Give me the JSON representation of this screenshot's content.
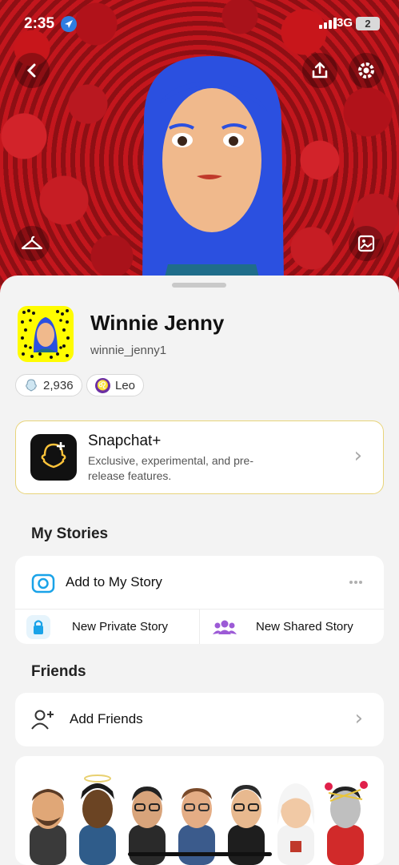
{
  "status_bar": {
    "time": "2:35",
    "network": "3G",
    "battery": "2"
  },
  "profile": {
    "display_name": "Winnie Jenny",
    "username": "winnie_jenny1",
    "score": "2,936",
    "zodiac": "Leo"
  },
  "snapchat_plus": {
    "title": "Snapchat+",
    "description": "Exclusive, experimental, and pre-release features."
  },
  "my_stories": {
    "heading": "My Stories",
    "add_label": "Add to My Story",
    "private_label": "New Private Story",
    "shared_label": "New Shared Story"
  },
  "friends": {
    "heading": "Friends",
    "add_label": "Add Friends"
  },
  "colors": {
    "snap_yellow": "#fffc00",
    "accent_blue": "#1aa3e8",
    "shared_purple": "#9c5ad6",
    "hair_blue": "#2b50e0"
  },
  "icons": [
    "back-arrow",
    "share-upload",
    "settings-gear",
    "hanger",
    "photo-frame",
    "location-arrow",
    "camera",
    "lock",
    "group",
    "add-friend",
    "chevron-right",
    "more-dots"
  ]
}
